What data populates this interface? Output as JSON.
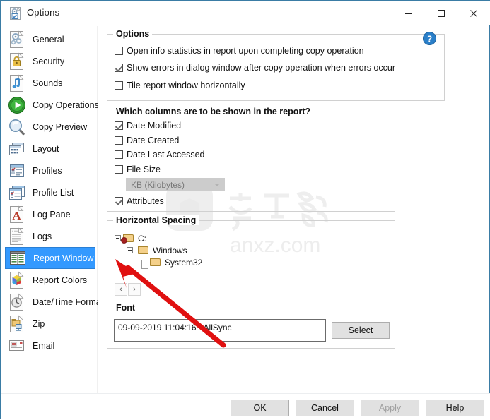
{
  "window": {
    "title": "Options",
    "icon": "options-gear-document-icon",
    "controls": {
      "minimize": "minimize-icon",
      "maximize": "maximize-icon",
      "close": "close-icon"
    },
    "border_color": "#3a7ca5"
  },
  "sidebar": {
    "selected": "Report Window",
    "selected_bg": "#3399ff",
    "items": [
      {
        "label": "General",
        "icon": "gear-document-icon"
      },
      {
        "label": "Security",
        "icon": "lock-document-icon"
      },
      {
        "label": "Sounds",
        "icon": "music-note-document-icon"
      },
      {
        "label": "Copy Operations",
        "icon": "green-play-circle-icon"
      },
      {
        "label": "Copy Preview",
        "icon": "magnifier-icon"
      },
      {
        "label": "Layout",
        "icon": "layout-windows-icon"
      },
      {
        "label": "Profiles",
        "icon": "profile-window-icon"
      },
      {
        "label": "Profile List",
        "icon": "profile-list-windows-icon"
      },
      {
        "label": "Log Pane",
        "icon": "letter-a-document-icon"
      },
      {
        "label": "Logs",
        "icon": "lined-document-icon"
      },
      {
        "label": "Report Window",
        "icon": "report-grid-icon"
      },
      {
        "label": "Report Colors",
        "icon": "color-wheel-document-icon"
      },
      {
        "label": "Date/Time Format",
        "icon": "clock-document-icon"
      },
      {
        "label": "Zip",
        "icon": "zip-folder-document-icon"
      },
      {
        "label": "Email",
        "icon": "envelope-icon"
      }
    ]
  },
  "help": {
    "icon": "help-question-icon",
    "label": "?"
  },
  "options_group": {
    "title": "Options",
    "checkboxes": [
      {
        "label": "Open info statistics in report upon completing copy operation",
        "checked": false
      },
      {
        "label": "Show errors in dialog window after copy operation when errors occur",
        "checked": true
      },
      {
        "label": "Tile report window horizontally",
        "checked": false
      }
    ]
  },
  "columns_group": {
    "title": "Which columns are to be shown in the report?",
    "checkboxes": [
      {
        "label": "Date Modified",
        "checked": true
      },
      {
        "label": "Date Created",
        "checked": false
      },
      {
        "label": "Date Last Accessed",
        "checked": false
      },
      {
        "label": "File Size",
        "checked": false
      },
      {
        "label": "Attributes",
        "checked": true
      }
    ],
    "size_unit": {
      "value": "KB (Kilobytes)",
      "disabled": true
    }
  },
  "spacing_group": {
    "title": "Horizontal Spacing",
    "tree": [
      {
        "label": "C:",
        "level": 0,
        "icon": "drive-folder-warning-icon",
        "expanded": true
      },
      {
        "label": "Windows",
        "level": 1,
        "icon": "folder-icon",
        "expanded": true
      },
      {
        "label": "System32",
        "level": 2,
        "icon": "folder-icon",
        "expanded": false
      }
    ],
    "nav": {
      "prev": "‹",
      "next": "›"
    }
  },
  "font_group": {
    "title": "Font",
    "preview_text": "09-09-2019 11:04:16 - AllSync",
    "select_label": "Select"
  },
  "buttons": [
    {
      "label": "OK",
      "disabled": false
    },
    {
      "label": "Cancel",
      "disabled": false
    },
    {
      "label": "Apply",
      "disabled": true
    },
    {
      "label": "Help",
      "disabled": false
    }
  ],
  "watermark": {
    "cjk": "安下载",
    "latin": "anxz.com"
  }
}
